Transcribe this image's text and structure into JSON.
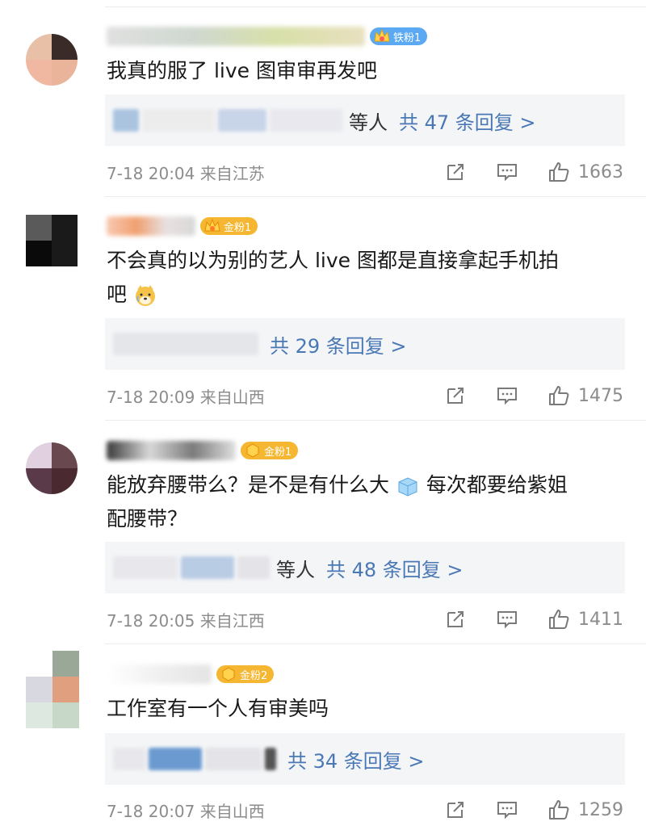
{
  "colors": {
    "link": "#4a78b5",
    "meta": "#8c8c8c",
    "iron_badge": "#5aa9f2",
    "gold_badge": "#f5b732",
    "reply_bg": "#f4f5f7"
  },
  "comments": [
    {
      "badge_label": "铁粉1",
      "badge_type": "iron",
      "text": "我真的服了 live 图审审再发吧",
      "reply_suffix": "等人",
      "reply_link": "共 47 条回复 >",
      "time_location": "7-18 20:04 来自江苏",
      "likes": "1663",
      "icons": [
        "share-icon",
        "comment-icon",
        "like-icon"
      ]
    },
    {
      "badge_label": "金粉1",
      "badge_type": "gold",
      "text_line1": "不会真的以为别的艺人 live 图都是直接拿起手机拍",
      "text_line2": "吧",
      "reply_suffix": "",
      "reply_link": "共 29 条回复 >",
      "time_location": "7-18 20:09 来自山西",
      "likes": "1475",
      "icons": [
        "share-icon",
        "comment-icon",
        "like-icon"
      ]
    },
    {
      "badge_label": "金粉1",
      "badge_type": "gold",
      "text_line1a": "能放弃腰带么？是不是有什么大",
      "text_line1b": "每次都要给紫姐",
      "text_line2": "配腰带？",
      "reply_suffix": "等人",
      "reply_link": "共 48 条回复 >",
      "time_location": "7-18 20:05 来自江西",
      "likes": "1411",
      "icons": [
        "share-icon",
        "comment-icon",
        "like-icon"
      ]
    },
    {
      "badge_label": "金粉2",
      "badge_type": "gold",
      "text": "工作室有一个人有审美吗",
      "reply_suffix": "",
      "reply_link": "共 34 条回复 >",
      "time_location": "7-18 20:07 来自山西",
      "likes": "1259",
      "icons": [
        "share-icon",
        "comment-icon",
        "like-icon"
      ]
    }
  ]
}
